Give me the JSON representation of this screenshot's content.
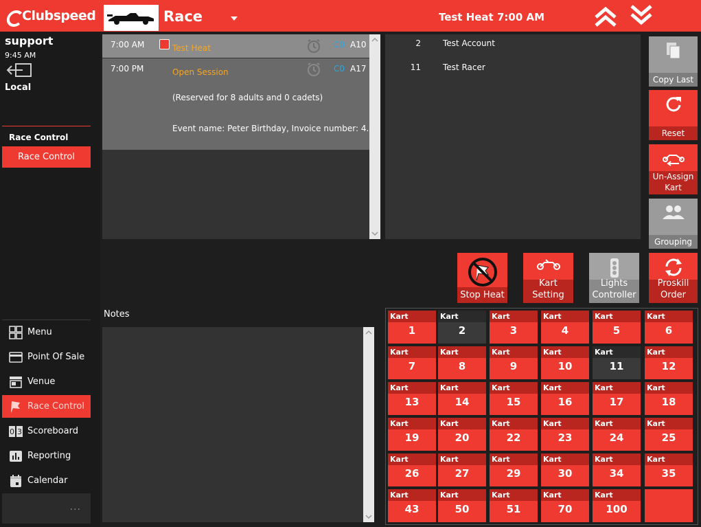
{
  "header": {
    "brand": "Clubspeed",
    "race_title": "Race",
    "heat_title": "Test Heat 7:00 AM"
  },
  "sidebar": {
    "user": "support",
    "time": "9:45 AM",
    "location": "Local",
    "section_heading": "Race Control",
    "section_button": "Race Control",
    "nav": [
      {
        "label": "Menu",
        "icon": "grid-icon"
      },
      {
        "label": "Point Of Sale",
        "icon": "credit-card-icon"
      },
      {
        "label": "Venue",
        "icon": "store-icon"
      },
      {
        "label": "Race Control",
        "icon": "flag-icon"
      },
      {
        "label": "Scoreboard",
        "icon": "scoreboard-icon"
      },
      {
        "label": "Reporting",
        "icon": "bar-chart-icon"
      },
      {
        "label": "Calendar",
        "icon": "calendar-icon"
      }
    ],
    "more": "..."
  },
  "heats": [
    {
      "time": "7:00 AM",
      "name": "Test Heat",
      "code": "C0",
      "track": "A10",
      "selected": true
    },
    {
      "time": "7:00 PM",
      "name": "Open Session",
      "code": "C0",
      "track": "A17",
      "selected": false,
      "reserved": "(Reserved for 8 adults and 0 cadets)",
      "event": "Event name: Peter Birthday, Invoice number: 4..."
    }
  ],
  "racers": [
    {
      "num": "2",
      "name": "Test Account"
    },
    {
      "num": "11",
      "name": "Test Racer"
    }
  ],
  "side_buttons": {
    "copy_last": "Copy Last",
    "reset": "Reset",
    "unassign": "Un-Assign Kart",
    "grouping": "Grouping"
  },
  "action_buttons": {
    "stop_heat": "Stop Heat",
    "kart_setting": "Kart Setting",
    "lights": "Lights Controller",
    "proskill": "Proskill Order"
  },
  "notes": {
    "label": "Notes"
  },
  "kart_label": "Kart",
  "karts": [
    {
      "num": "1",
      "state": "red"
    },
    {
      "num": "2",
      "state": "dark"
    },
    {
      "num": "3",
      "state": "red"
    },
    {
      "num": "4",
      "state": "red"
    },
    {
      "num": "5",
      "state": "red"
    },
    {
      "num": "6",
      "state": "red"
    },
    {
      "num": "7",
      "state": "red"
    },
    {
      "num": "8",
      "state": "red"
    },
    {
      "num": "9",
      "state": "red"
    },
    {
      "num": "10",
      "state": "red"
    },
    {
      "num": "11",
      "state": "dark"
    },
    {
      "num": "12",
      "state": "red"
    },
    {
      "num": "13",
      "state": "red"
    },
    {
      "num": "14",
      "state": "red"
    },
    {
      "num": "15",
      "state": "red"
    },
    {
      "num": "16",
      "state": "red"
    },
    {
      "num": "17",
      "state": "red"
    },
    {
      "num": "18",
      "state": "red"
    },
    {
      "num": "19",
      "state": "red"
    },
    {
      "num": "20",
      "state": "red"
    },
    {
      "num": "22",
      "state": "red"
    },
    {
      "num": "23",
      "state": "red"
    },
    {
      "num": "24",
      "state": "red"
    },
    {
      "num": "25",
      "state": "red"
    },
    {
      "num": "26",
      "state": "red"
    },
    {
      "num": "27",
      "state": "red"
    },
    {
      "num": "29",
      "state": "red"
    },
    {
      "num": "30",
      "state": "red"
    },
    {
      "num": "34",
      "state": "red"
    },
    {
      "num": "35",
      "state": "red"
    },
    {
      "num": "43",
      "state": "red"
    },
    {
      "num": "50",
      "state": "red"
    },
    {
      "num": "51",
      "state": "red"
    },
    {
      "num": "70",
      "state": "red"
    },
    {
      "num": "100",
      "state": "red"
    },
    {
      "num": "",
      "state": "empty"
    }
  ],
  "colors": {
    "accent": "#ee3a31",
    "accent_dark": "#b8261f",
    "heat_name": "#f5a623",
    "code": "#29a8e0"
  }
}
